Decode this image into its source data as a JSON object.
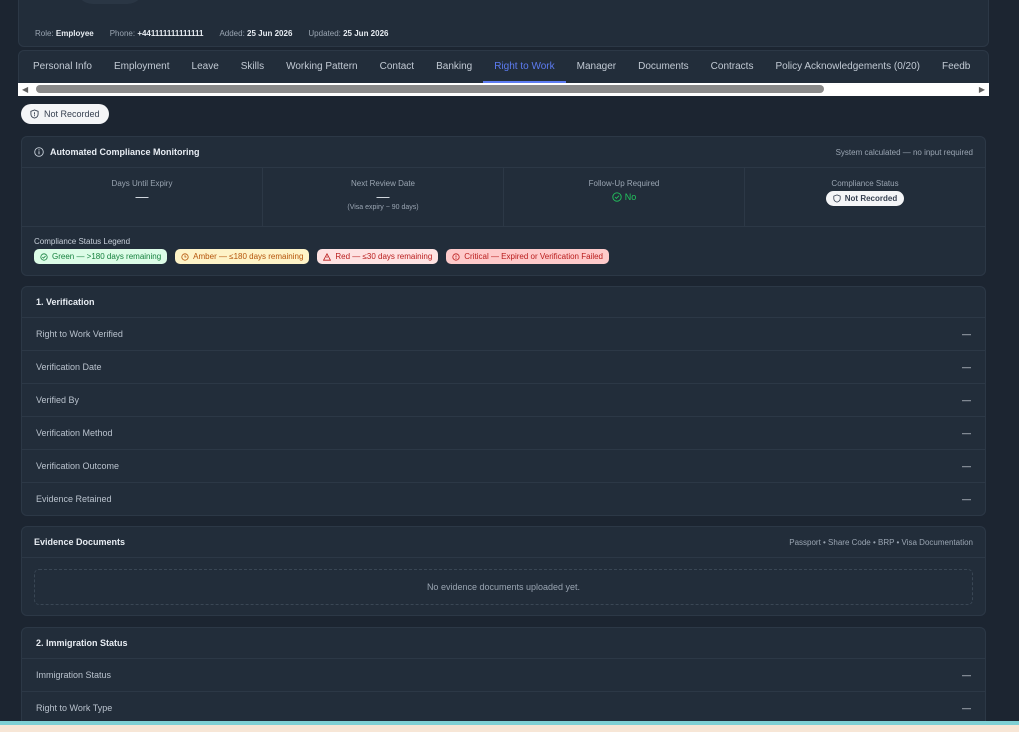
{
  "meta": {
    "role_label": "Role:",
    "role_value": "Employee",
    "phone_label": "Phone:",
    "phone_value": "+441111111111111",
    "added_label": "Added:",
    "added_value": "25 Jun 2026",
    "updated_label": "Updated:",
    "updated_value": "25 Jun 2026"
  },
  "tabs": [
    {
      "label": "Personal Info"
    },
    {
      "label": "Employment"
    },
    {
      "label": "Leave"
    },
    {
      "label": "Skills"
    },
    {
      "label": "Working Pattern"
    },
    {
      "label": "Contact"
    },
    {
      "label": "Banking"
    },
    {
      "label": "Right to Work"
    },
    {
      "label": "Manager"
    },
    {
      "label": "Documents"
    },
    {
      "label": "Contracts"
    },
    {
      "label": "Policy Acknowledgements (0/20)"
    },
    {
      "label": "Feedb"
    }
  ],
  "active_tab": "Right to Work",
  "status_pill": "Not Recorded",
  "compliance": {
    "title": "Automated Compliance Monitoring",
    "note": "System calculated — no input required",
    "days_label": "Days Until Expiry",
    "days_value": "—",
    "review_label": "Next Review Date",
    "review_value": "—",
    "review_sub": "(Visa expiry − 90 days)",
    "followup_label": "Follow-Up Required",
    "followup_value": "No",
    "status_label": "Compliance Status",
    "status_value": "Not Recorded",
    "legend_title": "Compliance Status Legend",
    "legend": {
      "green": "Green — >180 days remaining",
      "amber": "Amber — ≤180 days remaining",
      "red": "Red — ≤30 days remaining",
      "critical": "Critical — Expired or Verification Failed"
    }
  },
  "verification": {
    "title": "1. Verification",
    "rows": [
      {
        "label": "Right to Work Verified",
        "value": "—"
      },
      {
        "label": "Verification Date",
        "value": "—"
      },
      {
        "label": "Verified By",
        "value": "—"
      },
      {
        "label": "Verification Method",
        "value": "—"
      },
      {
        "label": "Verification Outcome",
        "value": "—"
      },
      {
        "label": "Evidence Retained",
        "value": "—"
      }
    ]
  },
  "evidence": {
    "title": "Evidence Documents",
    "note": "Passport • Share Code • BRP • Visa Documentation",
    "empty": "No evidence documents uploaded yet."
  },
  "immigration": {
    "title": "2. Immigration Status",
    "rows": [
      {
        "label": "Immigration Status",
        "value": "—"
      },
      {
        "label": "Right to Work Type",
        "value": "—"
      }
    ]
  },
  "colors": {
    "accent": "#5d7cf2",
    "green": "#22c55e",
    "background": "#1c2531"
  }
}
